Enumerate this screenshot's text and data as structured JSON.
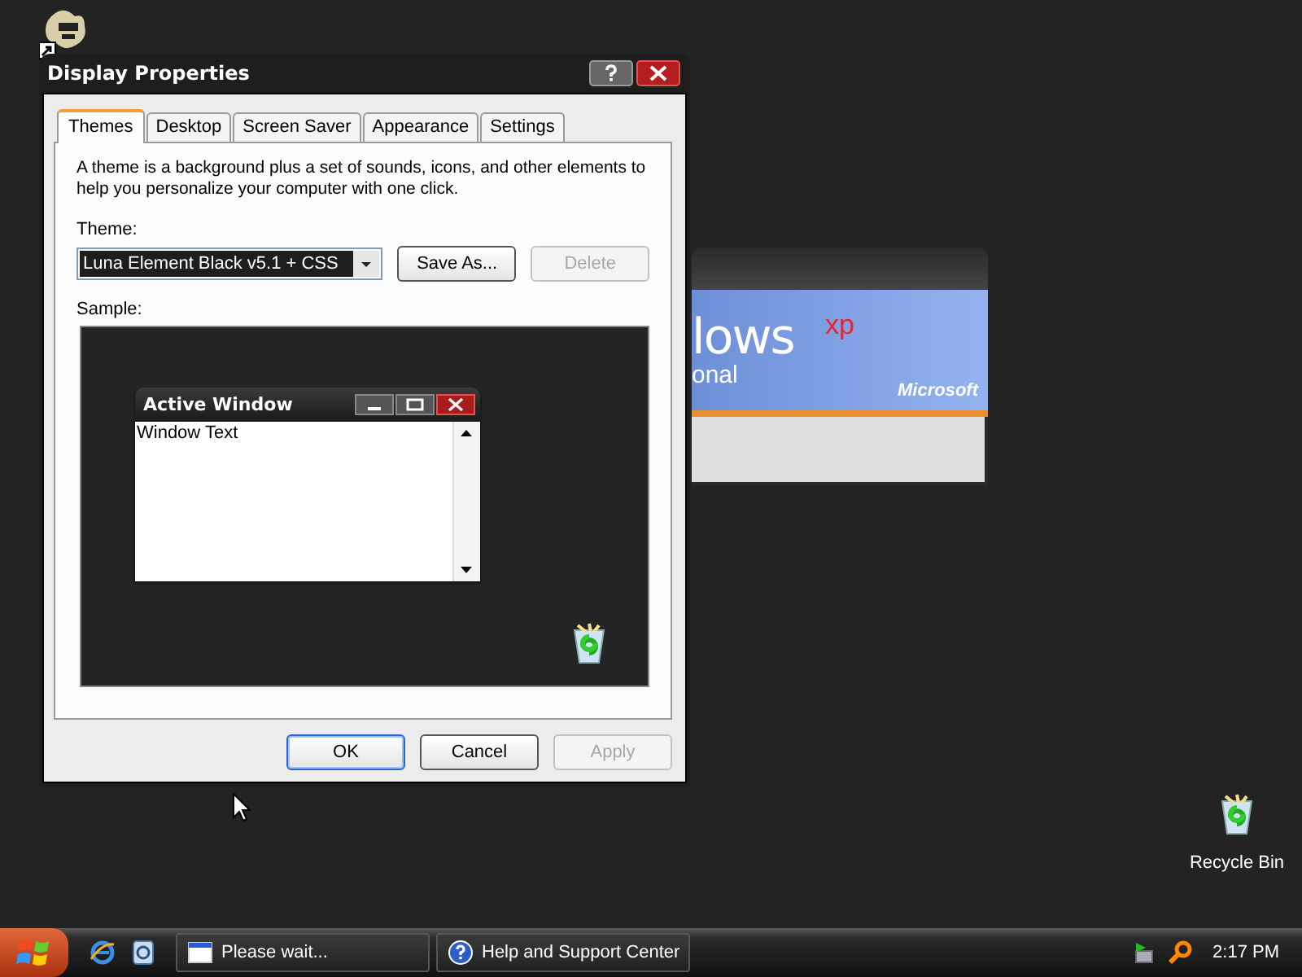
{
  "background_window": {
    "banner_word": "lows",
    "banner_sup": "xp",
    "banner_sub": "onal",
    "brand": "Microsoft"
  },
  "dialog": {
    "title": "Display Properties",
    "tabs": [
      {
        "label": "Themes",
        "selected": true
      },
      {
        "label": "Desktop",
        "selected": false
      },
      {
        "label": "Screen Saver",
        "selected": false
      },
      {
        "label": "Appearance",
        "selected": false
      },
      {
        "label": "Settings",
        "selected": false
      }
    ],
    "description": "A theme is a background plus a set of sounds, icons, and other elements to help you personalize your computer with one click.",
    "theme_label": "Theme:",
    "theme_value": "Luna Element Black v5.1 + CSS",
    "theme_buttons": [
      {
        "label": "Save As...",
        "disabled": false
      },
      {
        "label": "Delete",
        "disabled": true
      }
    ],
    "sample_label": "Sample:",
    "sample": {
      "window_title": "Active Window",
      "window_text": "Window Text"
    },
    "footer_buttons": [
      {
        "label": "OK",
        "disabled": false,
        "default": true
      },
      {
        "label": "Cancel",
        "disabled": false,
        "default": false
      },
      {
        "label": "Apply",
        "disabled": true,
        "default": false
      }
    ]
  },
  "desktop_icons": [
    {
      "label": "Recycle Bin"
    }
  ],
  "taskbar": {
    "tasks": [
      {
        "label": "Please wait...",
        "kind": "window"
      },
      {
        "label": "Help and Support Center",
        "kind": "help"
      }
    ],
    "clock": "2:17 PM"
  }
}
